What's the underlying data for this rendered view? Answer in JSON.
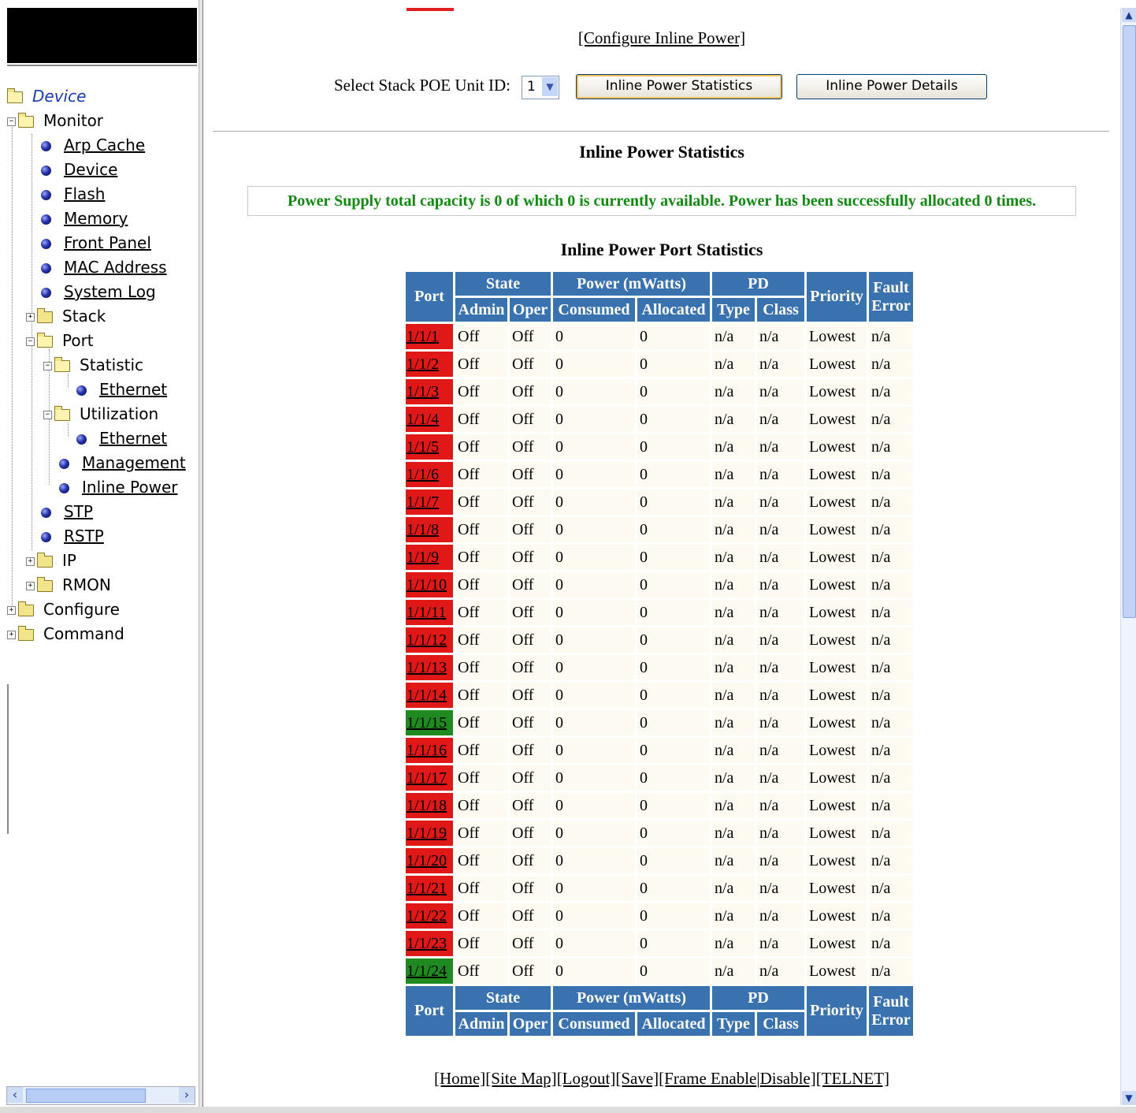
{
  "nav": {
    "root": "Device",
    "tree": [
      {
        "label": "Monitor"
      },
      {
        "label": "Arp Cache"
      },
      {
        "label": "Device"
      },
      {
        "label": "Flash"
      },
      {
        "label": "Memory"
      },
      {
        "label": "Front Panel"
      },
      {
        "label": "MAC Address"
      },
      {
        "label": "System Log"
      },
      {
        "label": "Stack"
      },
      {
        "label": "Port"
      },
      {
        "label": "Statistic"
      },
      {
        "label": "Ethernet"
      },
      {
        "label": "Utilization"
      },
      {
        "label": "Ethernet"
      },
      {
        "label": "Management"
      },
      {
        "label": "Inline Power"
      },
      {
        "label": "STP"
      },
      {
        "label": "RSTP"
      },
      {
        "label": "IP"
      },
      {
        "label": "RMON"
      },
      {
        "label": "Configure"
      },
      {
        "label": "Command"
      }
    ]
  },
  "main": {
    "configure_link": "[Configure Inline Power]",
    "select_label": "Select Stack POE Unit ID:",
    "unit_id": "1",
    "btn_stats": "Inline Power Statistics",
    "btn_details": "Inline Power Details",
    "title": "Inline Power Statistics",
    "info": "Power Supply total capacity is 0 of which 0 is currently available. Power has been successfully allocated 0 times.",
    "port_title": "Inline Power Port Statistics"
  },
  "table": {
    "headers": {
      "port": "Port",
      "state": "State",
      "power": "Power (mWatts)",
      "pd": "PD",
      "priority": "Priority",
      "fault1": "Fault",
      "fault2": "Error",
      "admin": "Admin",
      "oper": "Oper",
      "consumed": "Consumed",
      "allocated": "Allocated",
      "type": "Type",
      "class": "Class"
    },
    "rows": [
      {
        "port": "1/1/1",
        "status": "red",
        "admin": "Off",
        "oper": "Off",
        "consumed": "0",
        "allocated": "0",
        "type": "n/a",
        "class": "n/a",
        "priority": "Lowest",
        "fault": "n/a"
      },
      {
        "port": "1/1/2",
        "status": "red",
        "admin": "Off",
        "oper": "Off",
        "consumed": "0",
        "allocated": "0",
        "type": "n/a",
        "class": "n/a",
        "priority": "Lowest",
        "fault": "n/a"
      },
      {
        "port": "1/1/3",
        "status": "red",
        "admin": "Off",
        "oper": "Off",
        "consumed": "0",
        "allocated": "0",
        "type": "n/a",
        "class": "n/a",
        "priority": "Lowest",
        "fault": "n/a"
      },
      {
        "port": "1/1/4",
        "status": "red",
        "admin": "Off",
        "oper": "Off",
        "consumed": "0",
        "allocated": "0",
        "type": "n/a",
        "class": "n/a",
        "priority": "Lowest",
        "fault": "n/a"
      },
      {
        "port": "1/1/5",
        "status": "red",
        "admin": "Off",
        "oper": "Off",
        "consumed": "0",
        "allocated": "0",
        "type": "n/a",
        "class": "n/a",
        "priority": "Lowest",
        "fault": "n/a"
      },
      {
        "port": "1/1/6",
        "status": "red",
        "admin": "Off",
        "oper": "Off",
        "consumed": "0",
        "allocated": "0",
        "type": "n/a",
        "class": "n/a",
        "priority": "Lowest",
        "fault": "n/a"
      },
      {
        "port": "1/1/7",
        "status": "red",
        "admin": "Off",
        "oper": "Off",
        "consumed": "0",
        "allocated": "0",
        "type": "n/a",
        "class": "n/a",
        "priority": "Lowest",
        "fault": "n/a"
      },
      {
        "port": "1/1/8",
        "status": "red",
        "admin": "Off",
        "oper": "Off",
        "consumed": "0",
        "allocated": "0",
        "type": "n/a",
        "class": "n/a",
        "priority": "Lowest",
        "fault": "n/a"
      },
      {
        "port": "1/1/9",
        "status": "red",
        "admin": "Off",
        "oper": "Off",
        "consumed": "0",
        "allocated": "0",
        "type": "n/a",
        "class": "n/a",
        "priority": "Lowest",
        "fault": "n/a"
      },
      {
        "port": "1/1/10",
        "status": "red",
        "admin": "Off",
        "oper": "Off",
        "consumed": "0",
        "allocated": "0",
        "type": "n/a",
        "class": "n/a",
        "priority": "Lowest",
        "fault": "n/a"
      },
      {
        "port": "1/1/11",
        "status": "red",
        "admin": "Off",
        "oper": "Off",
        "consumed": "0",
        "allocated": "0",
        "type": "n/a",
        "class": "n/a",
        "priority": "Lowest",
        "fault": "n/a"
      },
      {
        "port": "1/1/12",
        "status": "red",
        "admin": "Off",
        "oper": "Off",
        "consumed": "0",
        "allocated": "0",
        "type": "n/a",
        "class": "n/a",
        "priority": "Lowest",
        "fault": "n/a"
      },
      {
        "port": "1/1/13",
        "status": "red",
        "admin": "Off",
        "oper": "Off",
        "consumed": "0",
        "allocated": "0",
        "type": "n/a",
        "class": "n/a",
        "priority": "Lowest",
        "fault": "n/a"
      },
      {
        "port": "1/1/14",
        "status": "red",
        "admin": "Off",
        "oper": "Off",
        "consumed": "0",
        "allocated": "0",
        "type": "n/a",
        "class": "n/a",
        "priority": "Lowest",
        "fault": "n/a"
      },
      {
        "port": "1/1/15",
        "status": "green",
        "admin": "Off",
        "oper": "Off",
        "consumed": "0",
        "allocated": "0",
        "type": "n/a",
        "class": "n/a",
        "priority": "Lowest",
        "fault": "n/a"
      },
      {
        "port": "1/1/16",
        "status": "red",
        "admin": "Off",
        "oper": "Off",
        "consumed": "0",
        "allocated": "0",
        "type": "n/a",
        "class": "n/a",
        "priority": "Lowest",
        "fault": "n/a"
      },
      {
        "port": "1/1/17",
        "status": "red",
        "admin": "Off",
        "oper": "Off",
        "consumed": "0",
        "allocated": "0",
        "type": "n/a",
        "class": "n/a",
        "priority": "Lowest",
        "fault": "n/a"
      },
      {
        "port": "1/1/18",
        "status": "red",
        "admin": "Off",
        "oper": "Off",
        "consumed": "0",
        "allocated": "0",
        "type": "n/a",
        "class": "n/a",
        "priority": "Lowest",
        "fault": "n/a"
      },
      {
        "port": "1/1/19",
        "status": "red",
        "admin": "Off",
        "oper": "Off",
        "consumed": "0",
        "allocated": "0",
        "type": "n/a",
        "class": "n/a",
        "priority": "Lowest",
        "fault": "n/a"
      },
      {
        "port": "1/1/20",
        "status": "red",
        "admin": "Off",
        "oper": "Off",
        "consumed": "0",
        "allocated": "0",
        "type": "n/a",
        "class": "n/a",
        "priority": "Lowest",
        "fault": "n/a"
      },
      {
        "port": "1/1/21",
        "status": "red",
        "admin": "Off",
        "oper": "Off",
        "consumed": "0",
        "allocated": "0",
        "type": "n/a",
        "class": "n/a",
        "priority": "Lowest",
        "fault": "n/a"
      },
      {
        "port": "1/1/22",
        "status": "red",
        "admin": "Off",
        "oper": "Off",
        "consumed": "0",
        "allocated": "0",
        "type": "n/a",
        "class": "n/a",
        "priority": "Lowest",
        "fault": "n/a"
      },
      {
        "port": "1/1/23",
        "status": "red",
        "admin": "Off",
        "oper": "Off",
        "consumed": "0",
        "allocated": "0",
        "type": "n/a",
        "class": "n/a",
        "priority": "Lowest",
        "fault": "n/a"
      },
      {
        "port": "1/1/24",
        "status": "green",
        "admin": "Off",
        "oper": "Off",
        "consumed": "0",
        "allocated": "0",
        "type": "n/a",
        "class": "n/a",
        "priority": "Lowest",
        "fault": "n/a"
      }
    ]
  },
  "footer": {
    "home": "[Home]",
    "site_map": "[Site Map]",
    "logout": "[Logout]",
    "save": "[Save]",
    "frame_enable": "[Frame Enable",
    "sep": "|",
    "disable": "Disable]",
    "telnet": "[TELNET]"
  },
  "colors": {
    "header_blue": "#3a72b0",
    "port_down": "#e01818",
    "port_up": "#1f8a1f",
    "info_green": "#108a10",
    "cell_bg": "#fdfbf1"
  },
  "icons": {
    "folder": "folder-icon",
    "open_folder": "folder-open-icon",
    "bullet": "bullet-icon",
    "expand": "plus-box-icon",
    "collapse": "minus-box-icon"
  }
}
